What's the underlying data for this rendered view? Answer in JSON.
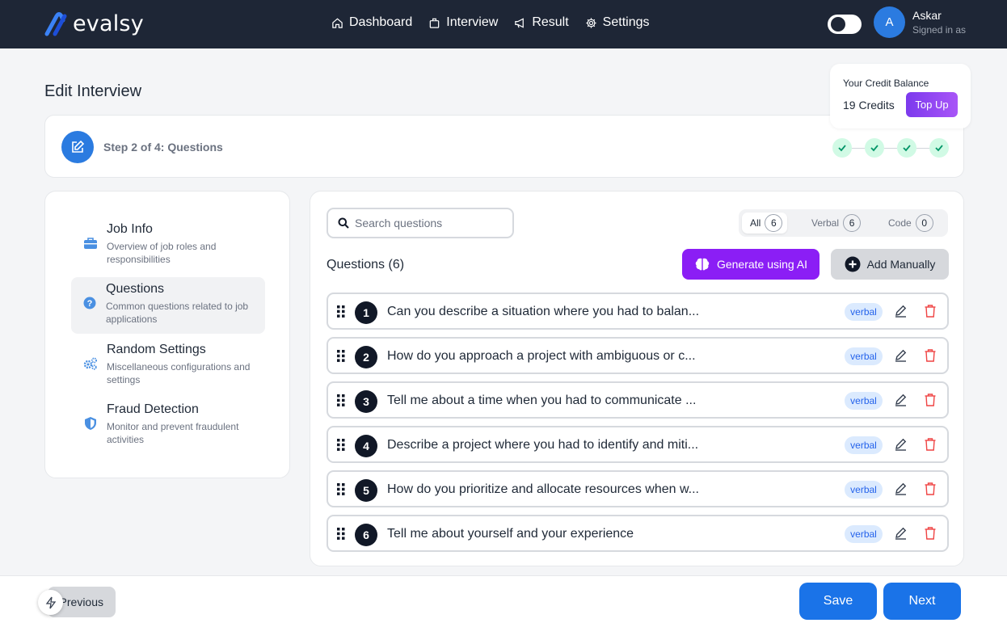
{
  "header": {
    "logo_text": "evalsy",
    "nav": [
      {
        "label": "Dashboard",
        "icon": "home-icon"
      },
      {
        "label": "Interview",
        "icon": "briefcase-icon"
      },
      {
        "label": "Result",
        "icon": "megaphone-icon"
      },
      {
        "label": "Settings",
        "icon": "gear-icon"
      }
    ],
    "user": {
      "initial": "A",
      "name": "Askar",
      "subtitle": "Signed in as"
    }
  },
  "page_title": "Edit Interview",
  "credit": {
    "label": "Your Credit Balance",
    "value": "19 Credits",
    "button": "Top Up"
  },
  "step": {
    "text": "Step 2 of 4: Questions",
    "total": 4,
    "completed": 4
  },
  "sidebar": {
    "items": [
      {
        "title": "Job Info",
        "desc": "Overview of job roles and responsibilities",
        "icon": "briefcase-icon",
        "active": false
      },
      {
        "title": "Questions",
        "desc": "Common questions related to job applications",
        "icon": "question-circle-icon",
        "active": true
      },
      {
        "title": "Random Settings",
        "desc": "Miscellaneous configurations and settings",
        "icon": "cogs-icon",
        "active": false
      },
      {
        "title": "Fraud Detection",
        "desc": "Monitor and prevent fraudulent activities",
        "icon": "shield-icon",
        "active": false
      }
    ]
  },
  "questions": {
    "search_placeholder": "Search questions",
    "filters": [
      {
        "label": "All",
        "count": "6",
        "active": true
      },
      {
        "label": "Verbal",
        "count": "6",
        "active": false
      },
      {
        "label": "Code",
        "count": "0",
        "active": false
      }
    ],
    "heading": "Questions (6)",
    "generate_label": "Generate using AI",
    "add_label": "Add Manually",
    "items": [
      {
        "num": "1",
        "text": "Can you describe a situation where you had to balan...",
        "type": "verbal"
      },
      {
        "num": "2",
        "text": "How do you approach a project with ambiguous or c...",
        "type": "verbal"
      },
      {
        "num": "3",
        "text": "Tell me about a time when you had to communicate ...",
        "type": "verbal"
      },
      {
        "num": "4",
        "text": "Describe a project where you had to identify and miti...",
        "type": "verbal"
      },
      {
        "num": "5",
        "text": "How do you prioritize and allocate resources when w...",
        "type": "verbal"
      },
      {
        "num": "6",
        "text": "Tell me about yourself and your experience",
        "type": "verbal"
      }
    ]
  },
  "footer": {
    "previous": "Previous",
    "save": "Save",
    "next": "Next"
  },
  "colors": {
    "header_bg": "#1e2636",
    "primary": "#1a73e8",
    "accent_purple": "#8b1ef5",
    "success_bg": "#d1fae5"
  }
}
